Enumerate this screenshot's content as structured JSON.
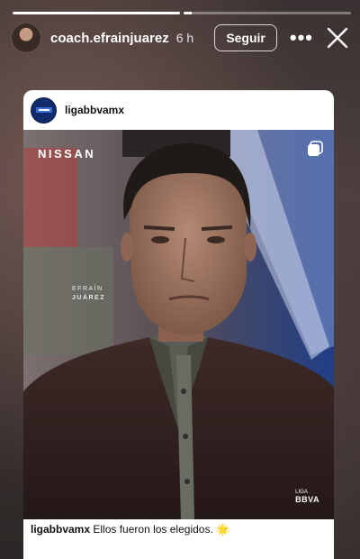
{
  "story": {
    "progress": [
      1,
      0.05
    ],
    "username": "coach.efrainjuarez",
    "time": "6 h",
    "follow_label": "Seguir"
  },
  "post": {
    "username": "ligabbvamx",
    "brand": "NISSAN",
    "name_first": "EFRAÍN",
    "name_last": "JUÁREZ",
    "league_top": "LIGA",
    "league_bottom": "BBVA",
    "caption_user": "ligabbvamx",
    "caption_text": "Ellos fueron los elegidos. 🌟"
  }
}
